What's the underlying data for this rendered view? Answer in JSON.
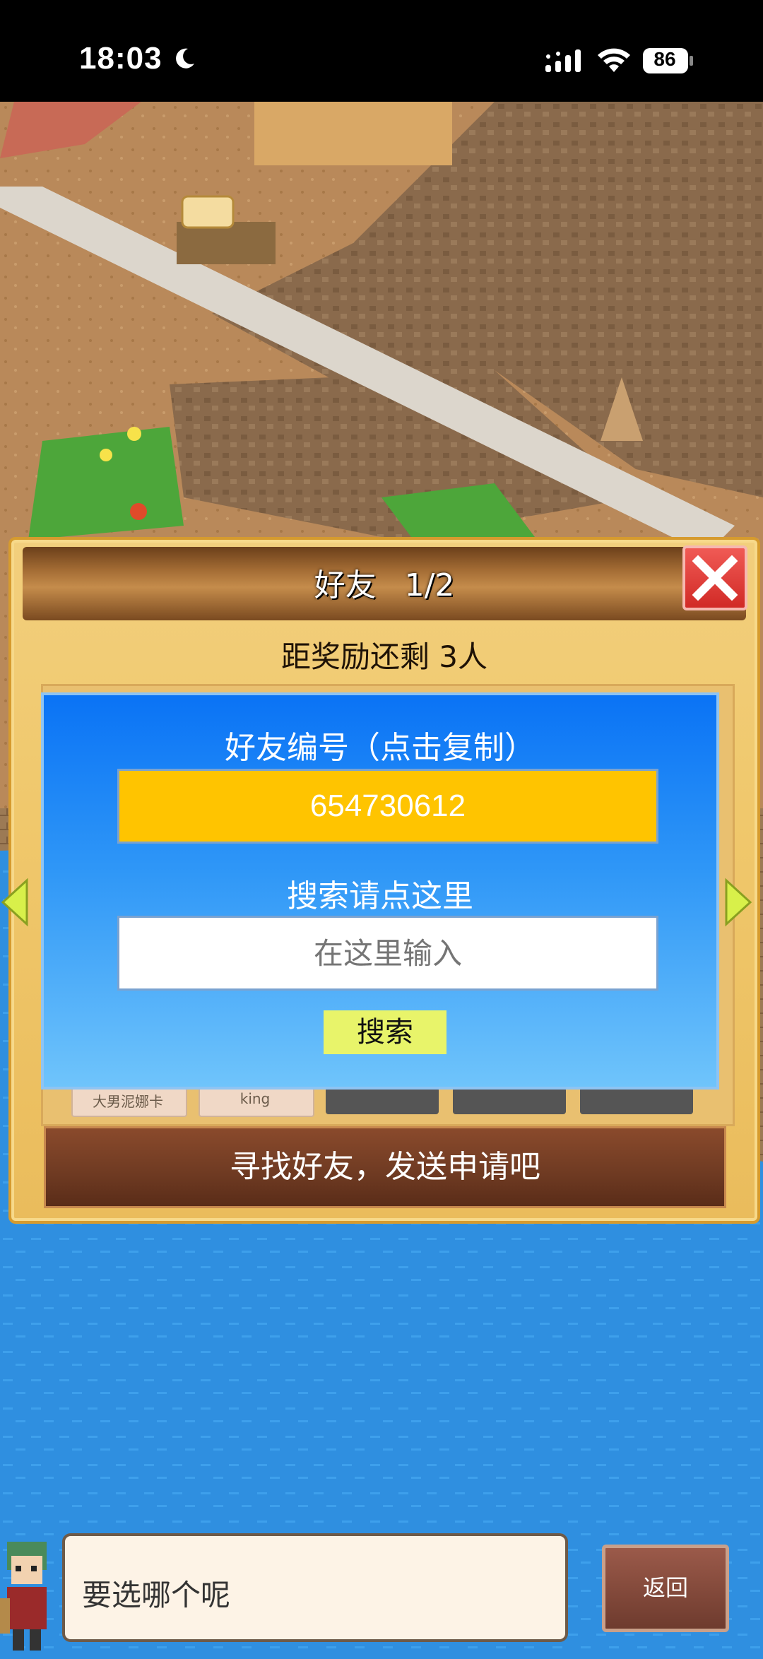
{
  "status_bar": {
    "time": "18:03",
    "battery": "86",
    "icons": [
      "moon-icon",
      "signal-icon",
      "wifi-icon",
      "battery-icon"
    ]
  },
  "panel": {
    "title": "好友",
    "page": "1/2",
    "reward_text": "距奖励还剩 3人",
    "slots": [
      "大男泥娜卡",
      "king"
    ],
    "find_friends_button": "寻找好友，发送申请吧"
  },
  "dialog": {
    "title": "好友编号（点击复制）",
    "friend_id": "654730612",
    "search_hint": "搜索请点这里",
    "search_placeholder": "在这里输入",
    "search_button": "搜索"
  },
  "bottom": {
    "message": "要选哪个呢",
    "back_button": "返回"
  },
  "colors": {
    "dialog_top": "#0a73f5",
    "id_box": "#ffc400",
    "search_button": "#e8f46a",
    "find_button": "#6e3a22"
  }
}
